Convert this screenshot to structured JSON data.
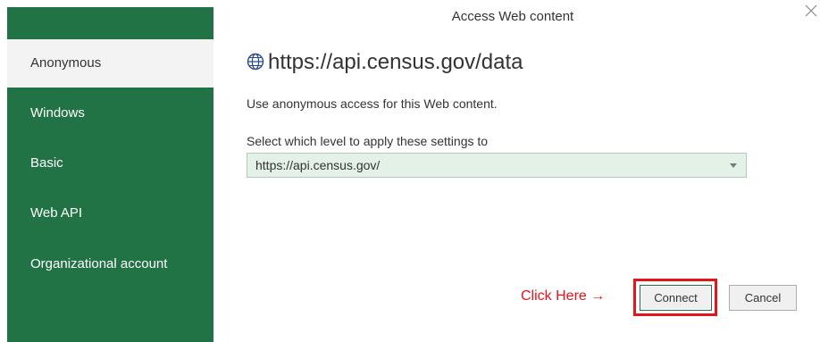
{
  "dialog": {
    "title": "Access Web content",
    "close_icon": "close-icon"
  },
  "sidebar": {
    "items": [
      {
        "label": "Anonymous",
        "selected": true
      },
      {
        "label": "Windows",
        "selected": false
      },
      {
        "label": "Basic",
        "selected": false
      },
      {
        "label": "Web API",
        "selected": false
      },
      {
        "label": "Organizational account",
        "selected": false
      }
    ],
    "background": "#217346",
    "selected_background": "#f3f3f3"
  },
  "main": {
    "url_icon": "globe-icon",
    "url": "https://api.census.gov/data",
    "description": "Use anonymous access for this Web content.",
    "level_label": "Select which level to apply these settings to",
    "level_select": {
      "value": "https://api.census.gov/"
    }
  },
  "annotation": {
    "text": "Click Here →",
    "color": "#e8121b"
  },
  "buttons": {
    "connect": "Connect",
    "cancel": "Cancel"
  }
}
